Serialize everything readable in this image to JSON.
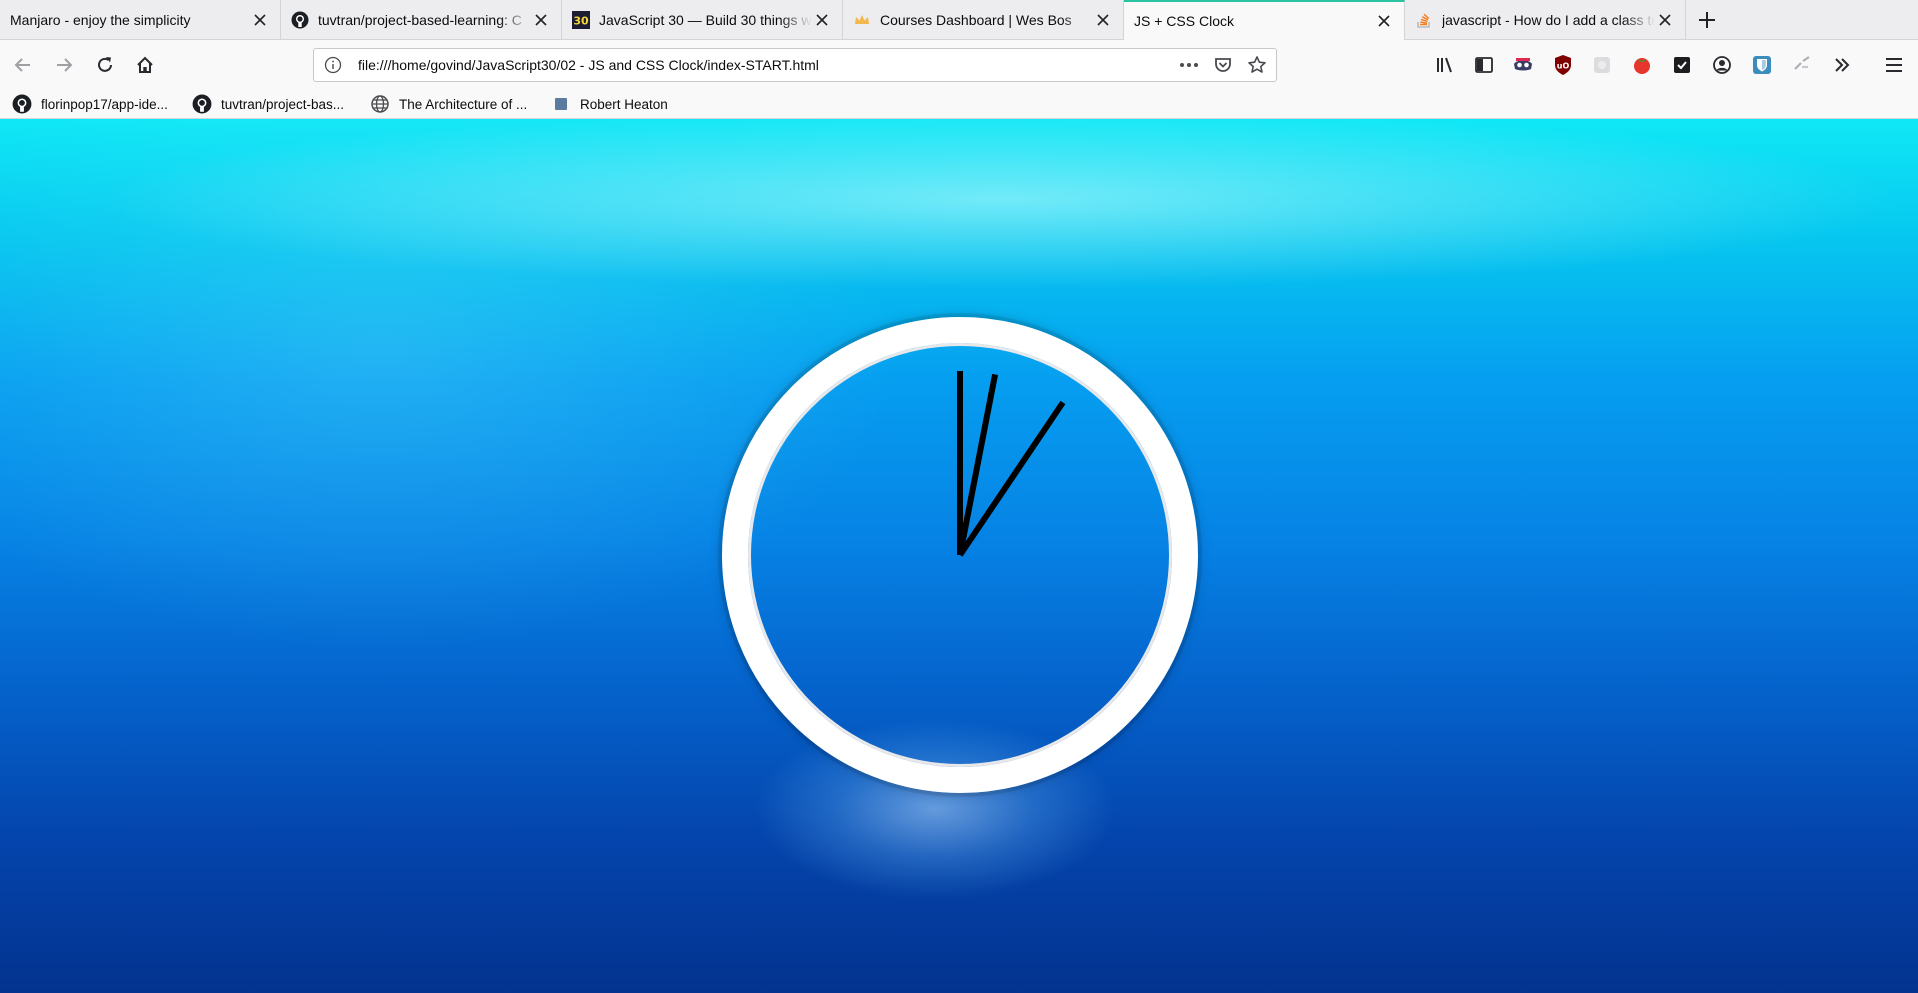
{
  "browser": {
    "tabs": [
      {
        "title": "Manjaro - enjoy the simplicity",
        "icon": "none",
        "active": false
      },
      {
        "title": "tuvtran/project-based-learning: C",
        "icon": "github-icon",
        "active": false
      },
      {
        "title": "JavaScript 30 — Build 30 things w",
        "icon": "javascript30-icon",
        "active": false
      },
      {
        "title": "Courses Dashboard | Wes Bos",
        "icon": "crown-icon",
        "active": false
      },
      {
        "title": "JS + CSS Clock",
        "icon": "none",
        "active": true
      },
      {
        "title": "javascript - How do I add a class to",
        "icon": "stackoverflow-icon",
        "active": false
      }
    ],
    "url": "file:///home/govind/JavaScript30/02 - JS and CSS Clock/index-START.html",
    "bookmarks": [
      {
        "label": "florinpop17/app-ide...",
        "icon": "github-icon"
      },
      {
        "label": "tuvtran/project-bas...",
        "icon": "github-icon"
      },
      {
        "label": "The Architecture of ...",
        "icon": "globe-icon"
      },
      {
        "label": "Robert Heaton",
        "icon": "bookmark-square-icon"
      }
    ],
    "colors": {
      "active_tab_accent": "#2ac3a2"
    }
  },
  "clock": {
    "hour_hand_angle_deg": 90,
    "minute_hand_angle_deg": 124,
    "second_hand_angle_deg": 101
  }
}
